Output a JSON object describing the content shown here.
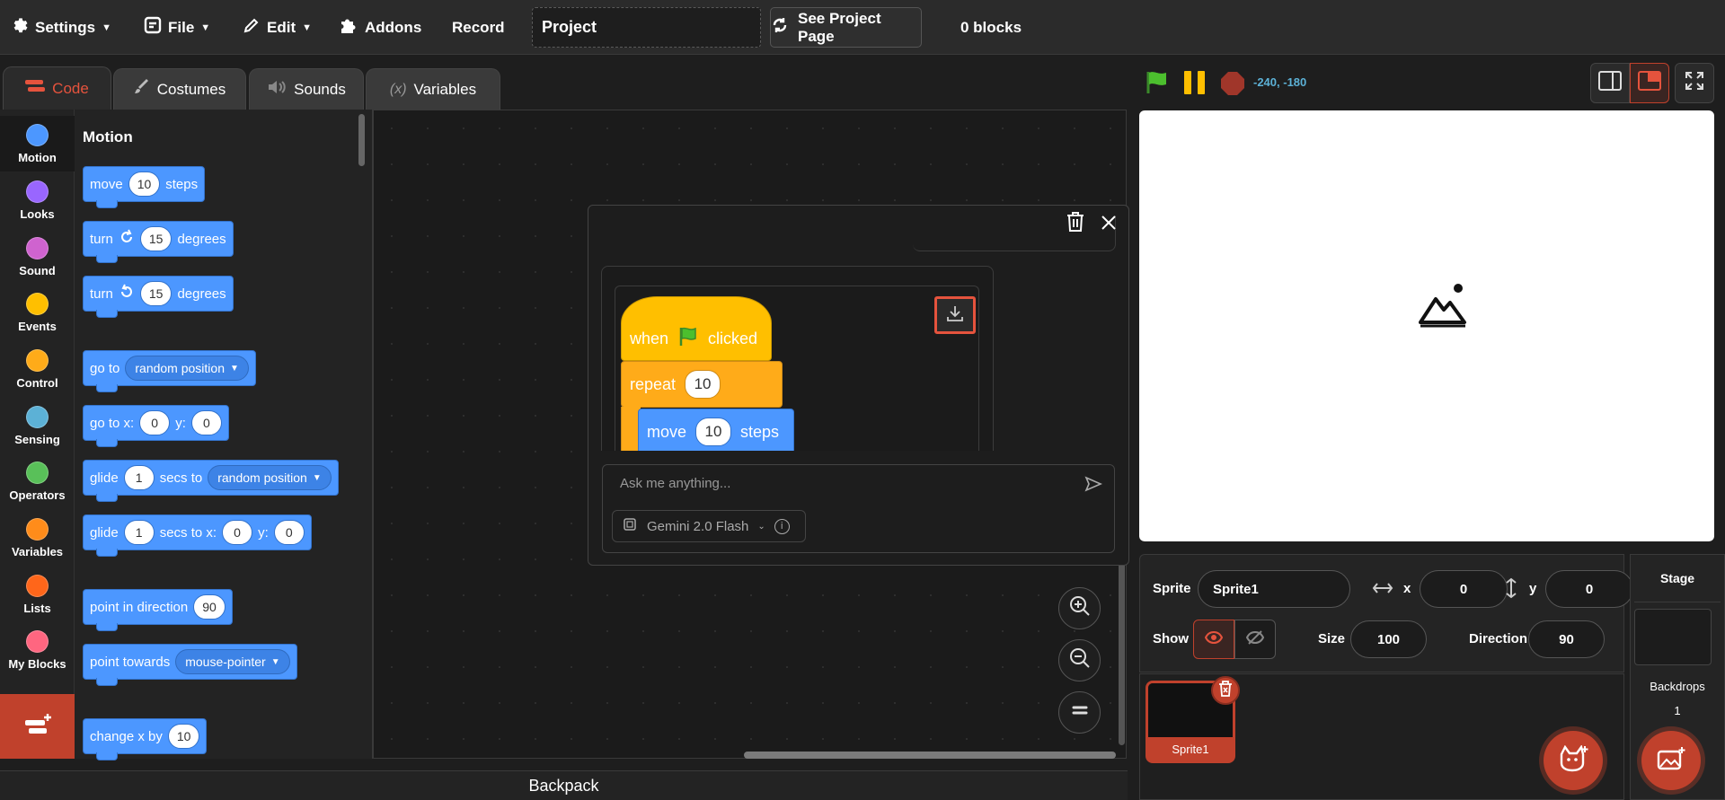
{
  "menubar": {
    "settings": "Settings",
    "file": "File",
    "edit": "Edit",
    "addons": "Addons",
    "record": "Record",
    "project_title": "Project",
    "see_project_page": "See Project Page",
    "block_count": "0 blocks"
  },
  "tabs": [
    {
      "label": "Code",
      "icon": "code-icon",
      "active": true
    },
    {
      "label": "Costumes",
      "icon": "brush-icon"
    },
    {
      "label": "Sounds",
      "icon": "speaker-icon"
    },
    {
      "label": "Variables",
      "icon": "variable-x-icon"
    }
  ],
  "categories": [
    {
      "label": "Motion",
      "color": "#4c97ff"
    },
    {
      "label": "Looks",
      "color": "#9966ff"
    },
    {
      "label": "Sound",
      "color": "#cf63cf"
    },
    {
      "label": "Events",
      "color": "#ffbf00"
    },
    {
      "label": "Control",
      "color": "#ffab19"
    },
    {
      "label": "Sensing",
      "color": "#5cb1d6"
    },
    {
      "label": "Operators",
      "color": "#59c059"
    },
    {
      "label": "Variables",
      "color": "#ff8c1a"
    },
    {
      "label": "Lists",
      "color": "#ff661a"
    },
    {
      "label": "My Blocks",
      "color": "#ff6680"
    }
  ],
  "palette": {
    "heading": "Motion",
    "move": {
      "a": "move",
      "v": "10",
      "b": "steps"
    },
    "turn_right": {
      "a": "turn",
      "v": "15",
      "b": "degrees"
    },
    "turn_left": {
      "a": "turn",
      "v": "15",
      "b": "degrees"
    },
    "goto": {
      "a": "go to",
      "menu": "random position"
    },
    "goto_xy": {
      "a": "go to x:",
      "x": "0",
      "yl": "y:",
      "y": "0"
    },
    "glide_to": {
      "a": "glide",
      "v": "1",
      "b": "secs to",
      "menu": "random position"
    },
    "glide_xy": {
      "a": "glide",
      "v": "1",
      "b": "secs to x:",
      "x": "0",
      "yl": "y:",
      "y": "0"
    },
    "point_dir": {
      "a": "point in direction",
      "v": "90"
    },
    "point_towards": {
      "a": "point towards",
      "menu": "mouse-pointer"
    },
    "change_x": {
      "a": "change x by",
      "v": "10"
    }
  },
  "assistant": {
    "script": {
      "when": "when",
      "clicked": "clicked",
      "repeat": "repeat",
      "repeat_v": "10",
      "move": "move",
      "move_v": "10",
      "steps": "steps"
    },
    "input_placeholder": "Ask me anything...",
    "model": "Gemini 2.0 Flash"
  },
  "stage_header": {
    "coords": "-240, -180"
  },
  "sprite_info": {
    "sprite_label": "Sprite",
    "sprite_name": "Sprite1",
    "x_label": "x",
    "x": "0",
    "y_label": "y",
    "y": "0",
    "show_label": "Show",
    "size_label": "Size",
    "size": "100",
    "direction_label": "Direction",
    "direction": "90"
  },
  "sprites": [
    {
      "name": "Sprite1"
    }
  ],
  "stage_pane": {
    "title": "Stage",
    "backdrops_label": "Backdrops",
    "backdrops_count": "1"
  },
  "backpack": "Backpack",
  "colors": {
    "accent": "#e5533d",
    "motion": "#4c97ff",
    "events": "#ffbf00",
    "control": "#ffab19"
  }
}
